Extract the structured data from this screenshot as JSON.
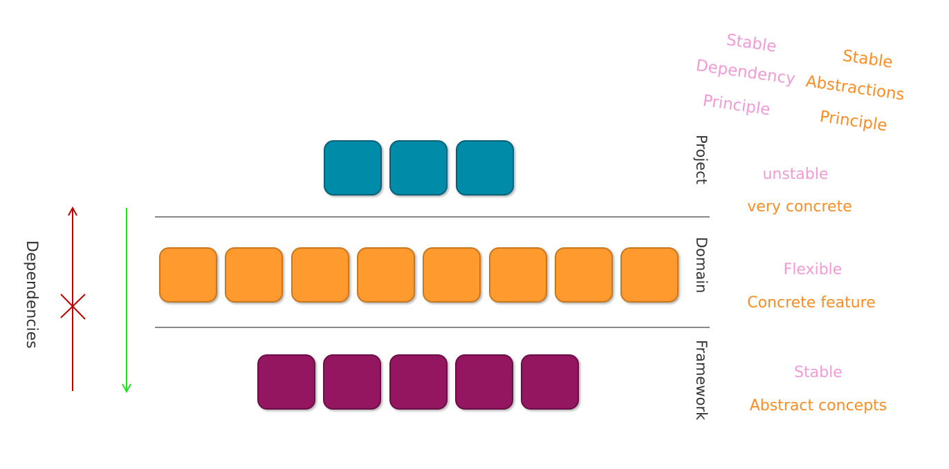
{
  "layers": [
    {
      "name": "Project",
      "box_count": 3,
      "color": "#008ba8",
      "traits": [
        "unstable",
        "very concrete"
      ]
    },
    {
      "name": "Domain",
      "box_count": 8,
      "color": "#ff9a2e",
      "traits": [
        "Flexible",
        "Concrete feature"
      ]
    },
    {
      "name": "Framework",
      "box_count": 5,
      "color": "#941660",
      "traits": [
        "Stable",
        "Abstract concepts"
      ]
    }
  ],
  "dependencies_label": "Dependencies",
  "arrows": {
    "up_color": "#c00000",
    "up_blocked": true,
    "down_color": "#22dd22"
  },
  "principles": {
    "sdp": [
      "Stable",
      "Dependency",
      "Principle"
    ],
    "sap": [
      "Stable",
      "Abstractions",
      "Principle"
    ]
  },
  "colors": {
    "pink": "#f29ad6",
    "orange": "#fb8d22"
  }
}
